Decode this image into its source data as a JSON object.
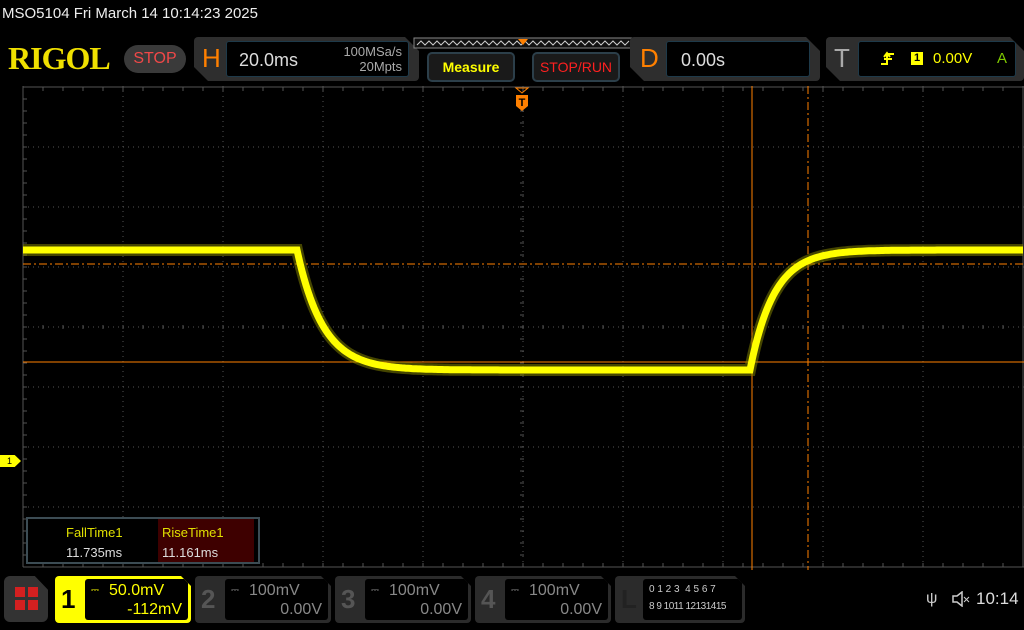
{
  "header": {
    "title": "MSO5104  Fri March 14 10:14:23 2025",
    "logo": "RIGOL",
    "run_state": "STOP"
  },
  "horizontal": {
    "label": "H",
    "timebase": "20.0ms",
    "sample_rate": "100MSa/s",
    "memory_depth": "20Mpts"
  },
  "buttons": {
    "measure": "Measure",
    "stop_run": "STOP/RUN"
  },
  "delay": {
    "label": "D",
    "value": "0.00s"
  },
  "trigger": {
    "label": "T",
    "type_icon": "rising-edge-icon",
    "source": "1",
    "level": "0.00V",
    "mode": "A"
  },
  "measurements": [
    {
      "name": "FallTime1",
      "value": "11.735ms"
    },
    {
      "name": "RiseTime1",
      "value": "11.161ms"
    }
  ],
  "channels": [
    {
      "num": "1",
      "scale": "50.0mV",
      "offset": "-112mV",
      "active": true
    },
    {
      "num": "2",
      "scale": "100mV",
      "offset": "0.00V",
      "active": false
    },
    {
      "num": "3",
      "scale": "100mV",
      "offset": "0.00V",
      "active": false
    },
    {
      "num": "4",
      "scale": "100mV",
      "offset": "0.00V",
      "active": false
    }
  ],
  "logic": {
    "label": "L",
    "row1": "0 1 2 3  4 5 6 7",
    "row2": "8 9 1011 12131415"
  },
  "status": {
    "time": "10:14",
    "usb_icon": "usb-icon",
    "sound_icon": "mute-icon"
  },
  "markers": {
    "trigger_marker": "T",
    "ch1_marker": "1"
  },
  "colors": {
    "ch1": "#ffff00",
    "cursor": "#ff8000",
    "accent": "#ff8000"
  }
}
